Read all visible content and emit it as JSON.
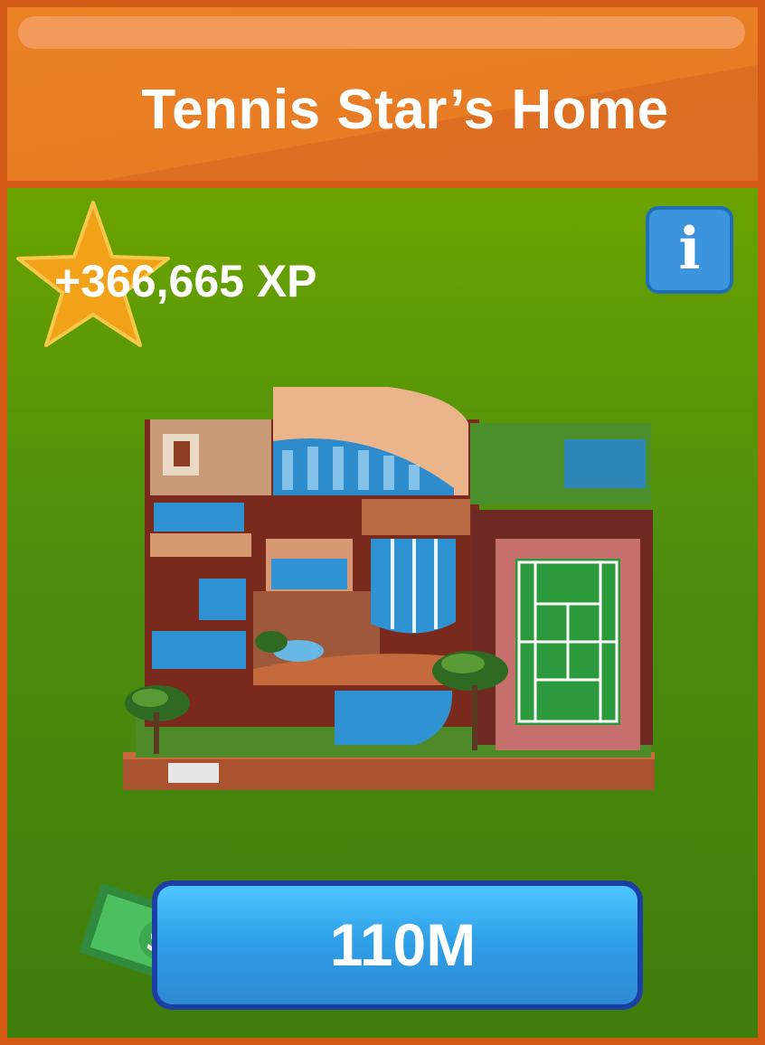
{
  "card": {
    "title": "Tennis Star’s Home",
    "xp_reward": "+366,665 XP",
    "info_label": "i",
    "price": "110M",
    "currency_symbol": "$"
  },
  "icons": {
    "xp": "star-icon",
    "info": "info-icon",
    "price": "cash-bill-icon"
  },
  "colors": {
    "header": "#e87c24",
    "frame": "#d35a14",
    "panel_top": "#6aa300",
    "panel_bottom": "#3f7d0c",
    "star": "#f2a218",
    "buy_button": "#2fa0e8",
    "info_button": "#3b94dc",
    "cash": "#3aa84e"
  }
}
